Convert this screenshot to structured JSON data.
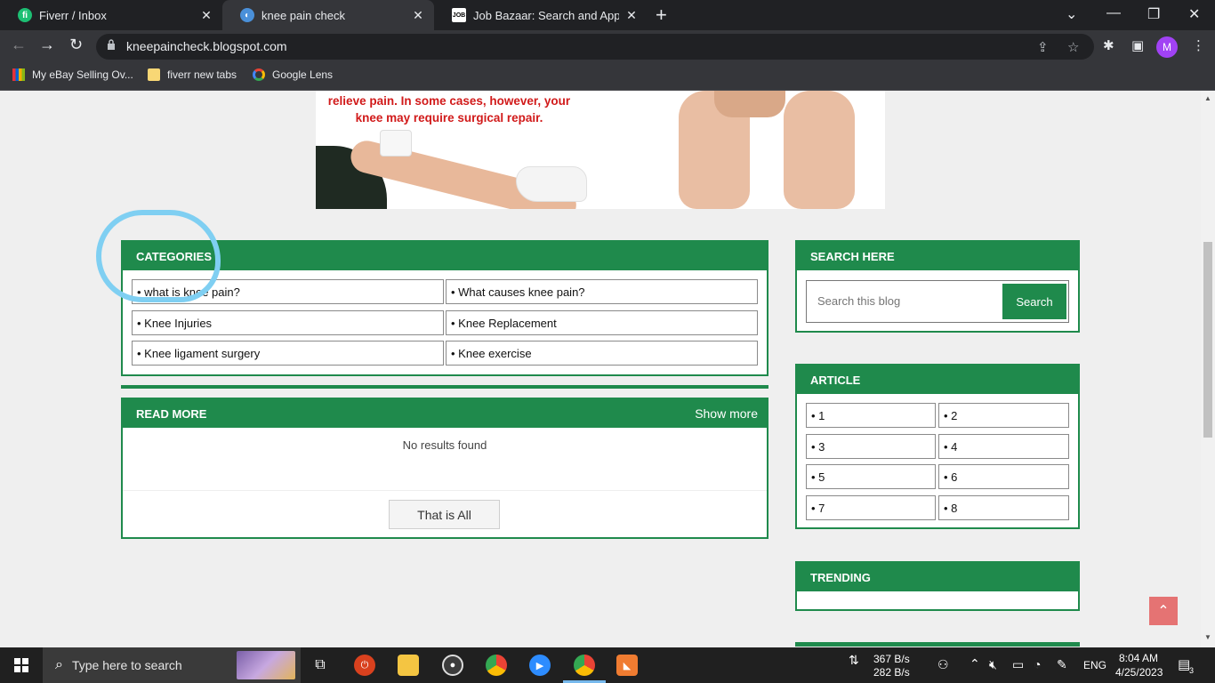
{
  "browser": {
    "tabs": [
      {
        "title": "Fiverr / Inbox",
        "favicon": "fiverr-icon",
        "color": "#1dbf73",
        "glyph": "fi"
      },
      {
        "title": "knee pain check",
        "favicon": "blogger-globe-icon",
        "color": "#4a90d9",
        "glyph": "◐"
      },
      {
        "title": "Job Bazaar: Search and Apply Lat",
        "favicon": "job-icon",
        "color": "#ffffff",
        "glyph": "JOB"
      }
    ],
    "url": "kneepaincheck.blogspot.com",
    "avatar_letter": "M",
    "bookmarks": [
      {
        "label": "My eBay Selling Ov...",
        "icon": "ebay-icon"
      },
      {
        "label": "fiverr new tabs",
        "icon": "folder-icon"
      },
      {
        "label": "Google Lens",
        "icon": "google-lens-icon"
      }
    ]
  },
  "page": {
    "hero_text": "relieve pain. In some cases, however, your knee may require surgical repair.",
    "categories": {
      "title": "CATEGORIES",
      "items": [
        "• what is knee pain?",
        "• What causes knee pain?",
        "• Knee Injuries",
        "• Knee Replacement",
        "• Knee ligament surgery",
        "• Knee exercise"
      ]
    },
    "read_more": {
      "title": "READ MORE",
      "show_more": "Show more",
      "empty_text": "No results found",
      "button": "That is All"
    },
    "search": {
      "title": "SEARCH HERE",
      "placeholder": "Search this blog",
      "button": "Search"
    },
    "article": {
      "title": "ARTICLE",
      "items": [
        "• 1",
        "• 2",
        "• 3",
        "• 4",
        "• 5",
        "• 6",
        "• 7",
        "• 8"
      ]
    },
    "trending": {
      "title": "TRENDING"
    }
  },
  "taskbar": {
    "search_text": "Type here to search",
    "net_up": "367 B/s",
    "net_down": "282 B/s",
    "language": "ENG",
    "time": "8:04 AM",
    "date": "4/25/2023",
    "notifications": "3"
  }
}
